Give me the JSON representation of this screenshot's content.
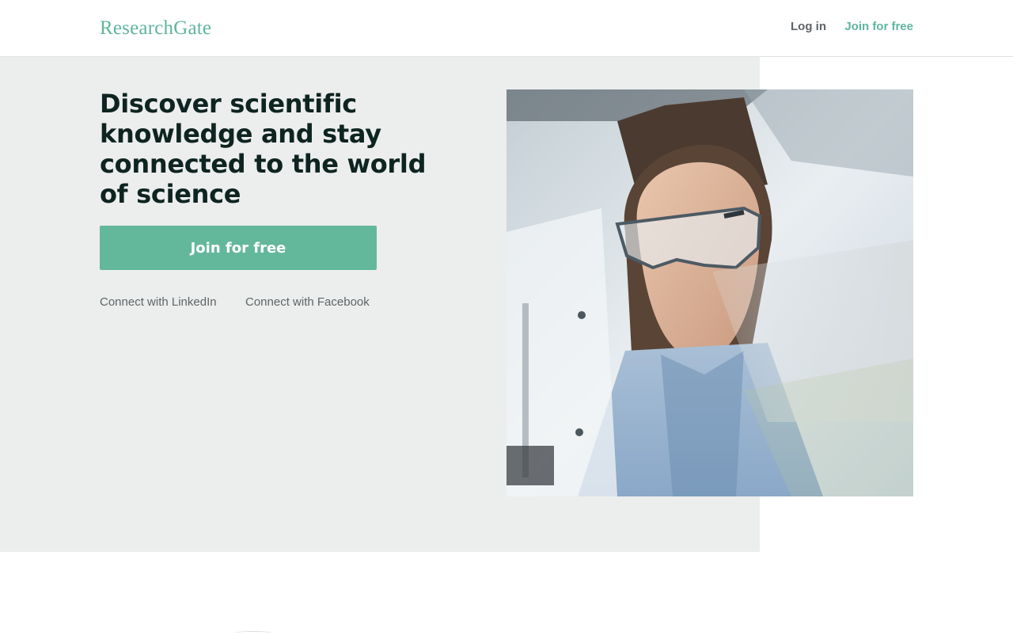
{
  "header": {
    "logo_text": "ResearchGate",
    "login_label": "Log in",
    "join_label": "Join for free"
  },
  "hero": {
    "headline": "Discover scientific knowledge and stay connected to the world of science",
    "cta_label": "Join for free",
    "connect_linkedin": "Connect with LinkedIn",
    "connect_facebook": "Connect with Facebook",
    "image_icon": "scientist-photo"
  },
  "colors": {
    "brand_green": "#5fb59b",
    "button_green": "#63b89b",
    "hero_background": "#eceeed",
    "headline_text": "#0e2421",
    "secondary_text": "#5e6468"
  }
}
